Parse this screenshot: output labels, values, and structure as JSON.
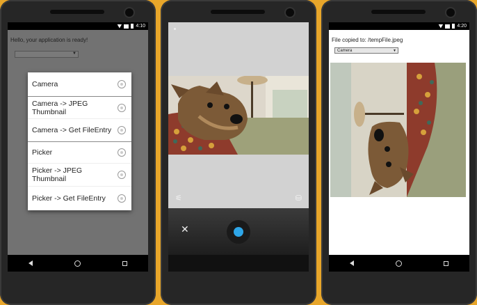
{
  "phone1": {
    "status": {
      "time": "4:10"
    },
    "hello_text": "Hello, your application is ready!",
    "options": [
      {
        "label": "Camera"
      },
      {
        "label": "Camera -> JPEG Thumbnail"
      },
      {
        "label": "Camera -> Get FileEntry"
      },
      {
        "label": "Picker"
      },
      {
        "label": "Picker -> JPEG Thumbnail"
      },
      {
        "label": "Picker -> Get FileEntry"
      }
    ]
  },
  "phone2": {
    "controls": {
      "close_glyph": "✕"
    }
  },
  "phone3": {
    "status": {
      "time": "4:20"
    },
    "copied_text": "File copied to: /tempFile.jpeg",
    "select_value": "Camera"
  },
  "colors": {
    "frame_bg": "#e8a62a",
    "shutter": "#2ea6e8"
  }
}
